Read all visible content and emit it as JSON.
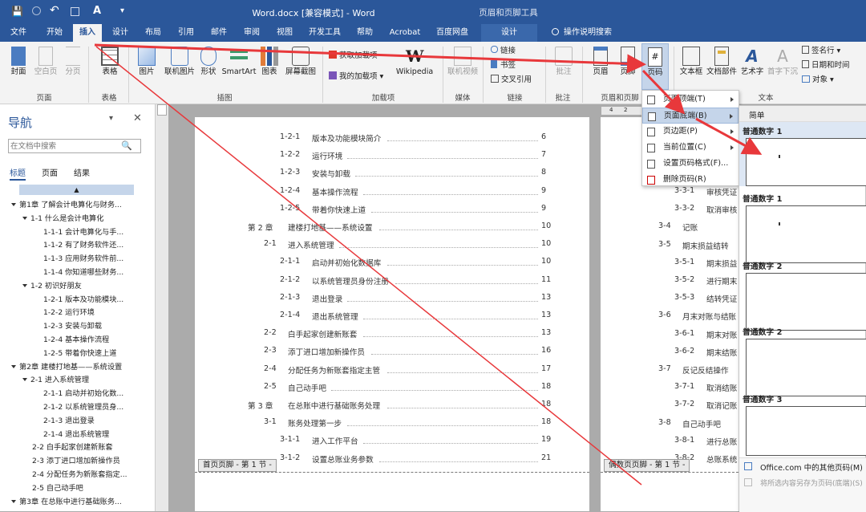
{
  "window": {
    "title": "Word.docx [兼容模式] - Word",
    "context_tab_group": "页眉和页脚工具"
  },
  "qat": {
    "save": "💾",
    "undo": "↶",
    "font_size": "A",
    "more": "▾"
  },
  "tabs": [
    "文件",
    "开始",
    "插入",
    "设计",
    "布局",
    "引用",
    "邮件",
    "审阅",
    "视图",
    "开发工具",
    "帮助",
    "Acrobat",
    "百度网盘"
  ],
  "context_tab": "设计",
  "tell_me": "操作说明搜索",
  "ribbon": {
    "pages": {
      "label": "页面",
      "items": [
        "封面",
        "空白页",
        "分页"
      ]
    },
    "tables": {
      "label": "表格",
      "items": [
        "表格"
      ]
    },
    "illustrations": {
      "label": "插图",
      "items": [
        "图片",
        "联机图片",
        "形状",
        "SmartArt",
        "图表",
        "屏幕截图"
      ]
    },
    "addins": {
      "label": "加载项",
      "items": [
        "获取加载项",
        "我的加载项",
        "Wikipedia"
      ]
    },
    "media": {
      "label": "媒体",
      "items": [
        "联机视频"
      ]
    },
    "links": {
      "label": "链接",
      "items": [
        "链接",
        "书签",
        "交叉引用"
      ]
    },
    "comments": {
      "label": "批注",
      "items": [
        "批注"
      ]
    },
    "hf": {
      "label": "页眉和页脚",
      "items": [
        "页眉",
        "页脚",
        "页码"
      ]
    },
    "text": {
      "label": "文本",
      "items": [
        "文本框",
        "文档部件",
        "艺术字",
        "首字下沉"
      ],
      "small": [
        "签名行",
        "日期和时间",
        "对象"
      ]
    }
  },
  "nav": {
    "title": "导航",
    "search_placeholder": "在文档中搜索",
    "tabs": [
      "标题",
      "页面",
      "结果"
    ],
    "items": [
      "第1章 了解会计电算化与财务...",
      "1-1 什么是会计电算化",
      "1-1-1 会计电算化与手...",
      "1-1-2 有了财务软件还...",
      "1-1-3 应用财务软件前...",
      "1-1-4 你知道哪些财务...",
      "1-2 初识好朋友",
      "1-2-1 版本及功能模块...",
      "1-2-2 运行环境",
      "1-2-3 安装与卸载",
      "1-2-4 基本操作流程",
      "1-2-5 带着你快速上道",
      "第2章 建楼打地基——系统设置",
      "2-1 进入系统管理",
      "2-1-1 启动并初始化数...",
      "2-1-2 以系统管理员身...",
      "2-1-3 退出登录",
      "2-1-4 退出系统管理",
      "2-2 白手起家创建新账套",
      "2-3 添丁进口增加新操作员",
      "2-4 分配任务为新账套指定...",
      "2-5 自己动手吧",
      "第3章 在总账中进行基础账务..."
    ]
  },
  "toc_left": [
    {
      "num": "1-2-1",
      "text": "版本及功能模块简介",
      "page": "6"
    },
    {
      "num": "1-2-2",
      "text": "运行环境",
      "page": "7"
    },
    {
      "num": "1-2-3",
      "text": "安装与卸载",
      "page": "8"
    },
    {
      "num": "1-2-4",
      "text": "基本操作流程",
      "page": "9"
    },
    {
      "num": "1-2-5",
      "text": "带着你快速上道",
      "page": "9"
    },
    {
      "num": "第 2 章",
      "text": "建楼打地基——系统设置",
      "page": "10"
    },
    {
      "num": "2-1",
      "text": "进入系统管理",
      "page": "10"
    },
    {
      "num": "2-1-1",
      "text": "启动并初始化数据库",
      "page": "10"
    },
    {
      "num": "2-1-2",
      "text": "以系统管理员身份注册",
      "page": "11"
    },
    {
      "num": "2-1-3",
      "text": "退出登录",
      "page": "13"
    },
    {
      "num": "2-1-4",
      "text": "退出系统管理",
      "page": "13"
    },
    {
      "num": "2-2",
      "text": "白手起家创建新账套",
      "page": "13"
    },
    {
      "num": "2-3",
      "text": "添丁进口增加新操作员",
      "page": "16"
    },
    {
      "num": "2-4",
      "text": "分配任务为新账套指定主管",
      "page": "17"
    },
    {
      "num": "2-5",
      "text": "自己动手吧",
      "page": "18"
    },
    {
      "num": "第 3 章",
      "text": "在总账中进行基础账务处理",
      "page": "18"
    },
    {
      "num": "3-1",
      "text": "账务处理第一步",
      "page": "18"
    },
    {
      "num": "3-1-1",
      "text": "进入工作平台",
      "page": "19"
    },
    {
      "num": "3-1-2",
      "text": "设置总账业务参数",
      "page": "21"
    }
  ],
  "toc_right": [
    {
      "num": "3-3-1",
      "text": "审核凭证"
    },
    {
      "num": "3-3-2",
      "text": "取消审核"
    },
    {
      "num": "3-4",
      "text": "记账"
    },
    {
      "num": "3-5",
      "text": "期末损益结转"
    },
    {
      "num": "3-5-1",
      "text": "期末损益"
    },
    {
      "num": "3-5-2",
      "text": "进行期末"
    },
    {
      "num": "3-5-3",
      "text": "结转凭证"
    },
    {
      "num": "3-6",
      "text": "月末对账与结账"
    },
    {
      "num": "3-6-1",
      "text": "期末对账"
    },
    {
      "num": "3-6-2",
      "text": "期末结账"
    },
    {
      "num": "3-7",
      "text": "反记反结操作"
    },
    {
      "num": "3-7-1",
      "text": "取消结账"
    },
    {
      "num": "3-7-2",
      "text": "取消记账"
    },
    {
      "num": "3-8",
      "text": "自己动手吧"
    },
    {
      "num": "3-8-1",
      "text": "进行总账"
    },
    {
      "num": "3-8-2",
      "text": "总账系统"
    }
  ],
  "footer_labels": {
    "left": "首页页脚 - 第 1 节 -",
    "right": "偶数页页脚 - 第 1 节 -"
  },
  "page_number_menu": [
    "页面顶端(T)",
    "页面底端(B)",
    "页边距(P)",
    "当前位置(C)",
    "设置页码格式(F)...",
    "删除页码(R)"
  ],
  "gallery": {
    "section": "简单",
    "items": [
      "普通数字 1",
      "普通数字 1",
      "普通数字 2",
      "普通数字 2",
      "普通数字 3"
    ],
    "footer": [
      "Office.com 中的其他页码(M)",
      "将所选内容另存为页码(底端)(S)"
    ]
  },
  "ruler_marks": [
    "4",
    "2",
    "2",
    "4"
  ],
  "colors": {
    "accent": "#2b579a",
    "arrow": "#e8383b"
  }
}
